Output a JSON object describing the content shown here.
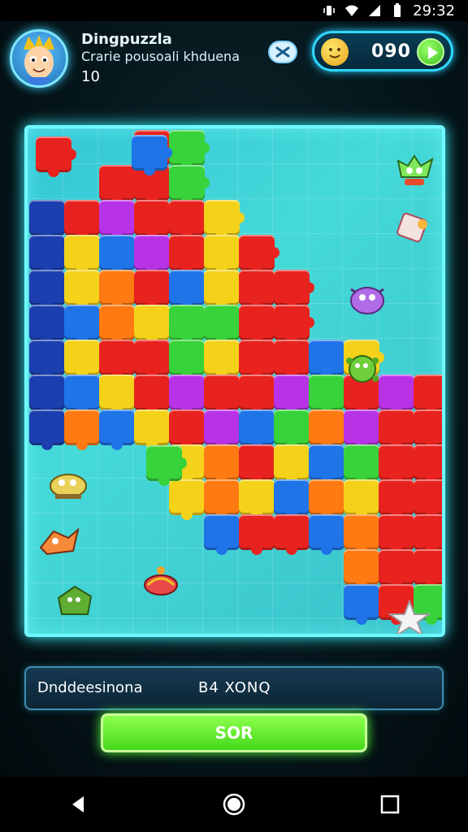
{
  "status_bar": {
    "time": "29:32"
  },
  "header": {
    "player_name": "Dingpuzzla",
    "player_subtitle": "Crarie pousoali khduena",
    "player_level": "10",
    "coin_count": "090"
  },
  "board": {
    "pieces": [
      {
        "color": "#e8231f"
      },
      {
        "color": "#1f74e8"
      },
      {
        "color": "#38d23a"
      },
      {
        "color": "#f4d21a"
      },
      {
        "color": "#b833e6"
      },
      {
        "color": "#ff7a12"
      },
      {
        "color": "#1b3fae"
      }
    ],
    "critters": [
      "green-monster-icon",
      "puzzle-piece-icon",
      "purple-blob-icon",
      "green-virus-icon",
      "yellow-bug-icon",
      "flying-fox-icon",
      "green-creature-icon",
      "red-snail-icon",
      "star-icon"
    ]
  },
  "status_panel": {
    "label": "Dnddeesinona",
    "value": "B4 XONQ"
  },
  "action_button": {
    "label": "SOR"
  },
  "colors": {
    "board_border": "#6ff9ff",
    "accent_green": "#45d81c",
    "accent_cyan": "#2fd8ff"
  }
}
